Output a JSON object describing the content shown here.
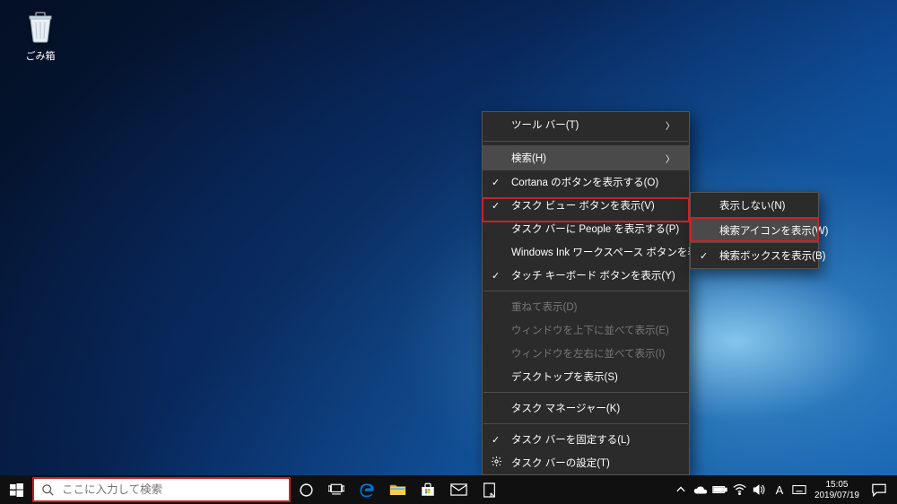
{
  "desktop": {
    "recycle_bin_label": "ごみ箱"
  },
  "taskbar": {
    "search_placeholder": "ここに入力して検索",
    "clock_time": "15:05",
    "clock_date": "2019/07/19"
  },
  "context_menu": {
    "toolbar": "ツール バー(T)",
    "search": "検索(H)",
    "cortana_button": "Cortana のボタンを表示する(O)",
    "taskview_button": "タスク ビュー ボタンを表示(V)",
    "people": "タスク バーに People を表示する(P)",
    "ink_workspace": "Windows Ink ワークスペース ボタンを表示(W)",
    "touch_keyboard": "タッチ キーボード ボタンを表示(Y)",
    "cascade": "重ねて表示(D)",
    "stack_v": "ウィンドウを上下に並べて表示(E)",
    "stack_h": "ウィンドウを左右に並べて表示(I)",
    "show_desktop": "デスクトップを表示(S)",
    "task_manager": "タスク マネージャー(K)",
    "lock_taskbar": "タスク バーを固定する(L)",
    "taskbar_settings": "タスク バーの設定(T)"
  },
  "search_submenu": {
    "hidden": "表示しない(N)",
    "show_icon": "検索アイコンを表示(W)",
    "show_box": "検索ボックスを表示(B)"
  }
}
